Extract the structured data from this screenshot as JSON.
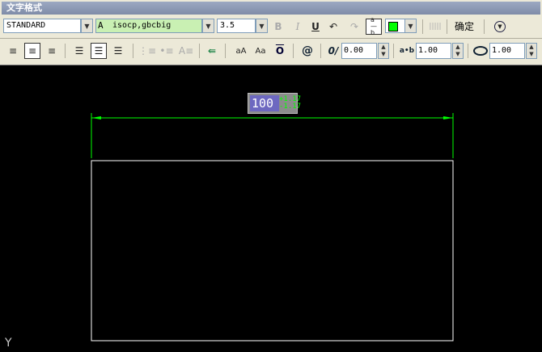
{
  "title": "文字格式",
  "style_combo": "STANDARD",
  "font_combo": "isocp,gbcbig",
  "height_combo": "3.5",
  "toolbar": {
    "bold": "B",
    "italic": "I",
    "underline": "U",
    "ok": "确定"
  },
  "colors": {
    "text_color": "#00ff00",
    "accent": "#6d68c0"
  },
  "row2": {
    "oblique_label": "0/",
    "oblique_value": "0.00",
    "tracking_label": "a•b",
    "tracking_value": "1.00",
    "width_value": "1.00",
    "insert_field": "@",
    "case_upper": "aA",
    "case_lower": "Aa"
  },
  "drawing": {
    "dim_value": "100",
    "tol_upper": "+1.17",
    "tol_lower": "-1.17",
    "ucs": "Y"
  }
}
